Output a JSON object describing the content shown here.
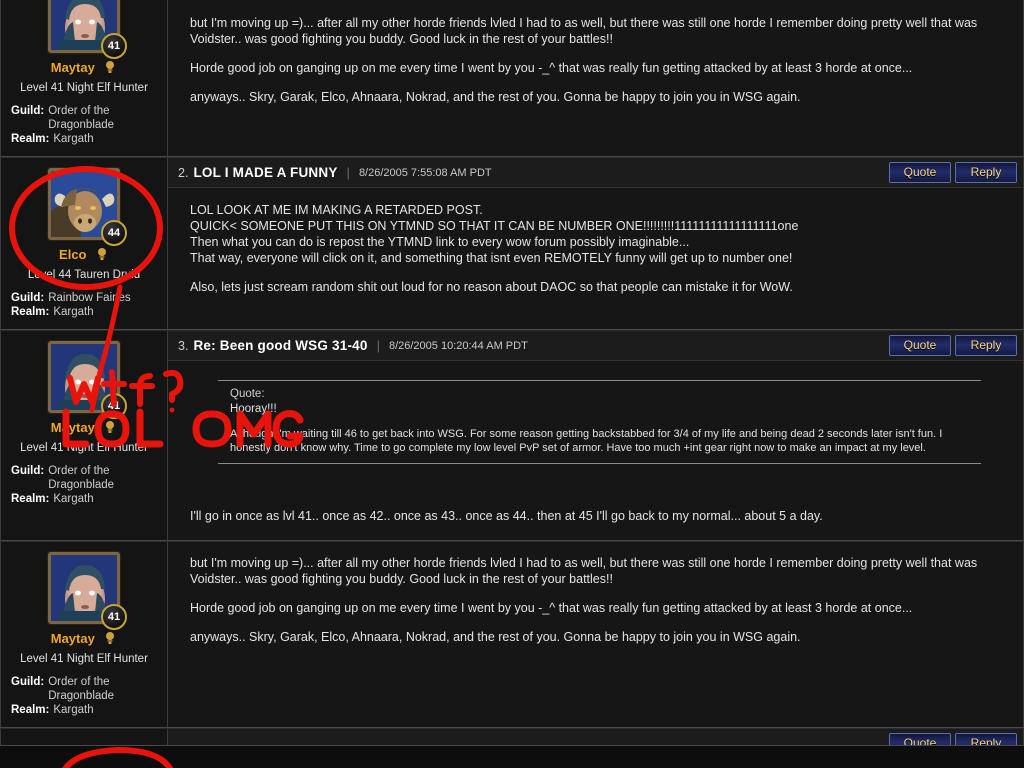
{
  "theme": {
    "page_bg": "#0d0d0d",
    "post_bg": "#161616",
    "author_bg": "#141414",
    "name_color": "#f0a81e",
    "button_text": "#f5d77a",
    "button_bg": "#232c6b",
    "ink_color": "#e8140c"
  },
  "buttons": {
    "quote": "Quote",
    "reply": "Reply"
  },
  "posts": [
    {
      "number": "",
      "title": "",
      "date": "",
      "author": {
        "name": "Maytay",
        "level": "41",
        "title": "Level 41 Night Elf Hunter",
        "guild_label": "Guild:",
        "guild": "Order of the Dragonblade",
        "realm_label": "Realm:",
        "realm": "Kargath",
        "class_icon": "hunter-class-icon",
        "avatar": "night-elf-female-avatar"
      },
      "paragraphs": [
        "but I'm moving up =)... after all my other horde friends lvled I had to as well, but there was still one horde I remember doing pretty well that was Voidster.. was good fighting you buddy. Good luck in the rest of your battles!!",
        "Horde good job on ganging up on me every time I went by you -_^ that was really fun getting attacked by at least 3 horde at once...",
        "anyways.. Skry, Garak, Elco, Ahnaara, Nokrad, and the rest of you. Gonna be happy to join you in WSG again."
      ]
    },
    {
      "number": "2.",
      "title": "LOL I MADE A FUNNY",
      "date": "8/26/2005 7:55:08 AM PDT",
      "author": {
        "name": "Elco",
        "level": "44",
        "title": "Level 44 Tauren Druid",
        "guild_label": "Guild:",
        "guild": "Rainbow Fairies",
        "realm_label": "Realm:",
        "realm": "Kargath",
        "class_icon": "druid-class-icon",
        "avatar": "tauren-male-avatar"
      },
      "lines": [
        "LOL LOOK AT ME IM MAKING A RETARDED POST.",
        "QUICK< SOMEONE PUT THIS ON YTMND SO THAT IT CAN BE NUMBER ONE!!!!!!!!!11111111111111111one",
        "Then what you can do is repost the YTMND link to every wow forum possibly imaginable...",
        "That way, everyone will click on it, and something that isnt even REMOTELY funny will get up to number one!"
      ],
      "closing": "Also, lets just scream random shit out loud for no reason about DAOC so that people can mistake it for WoW."
    },
    {
      "number": "3.",
      "title": "Re: Been good WSG 31-40",
      "date": "8/26/2005 10:20:44 AM PDT",
      "author": {
        "name": "Maytay",
        "level": "41",
        "title": "Level 41 Night Elf Hunter",
        "guild_label": "Guild:",
        "guild": "Order of the Dragonblade",
        "realm_label": "Realm:",
        "realm": "Kargath",
        "class_icon": "hunter-class-icon",
        "avatar": "night-elf-female-avatar"
      },
      "quote": {
        "label": "Quote:",
        "first_line": "Hooray!!!",
        "text": "Although I'm waiting till 46 to get back into WSG. For some reason getting backstabbed for 3/4 of my life and being dead 2 seconds later isn't fun. I honestly don't know why. Time to go complete my low level PvP set of armor. Have too much +int gear right now to make an impact at my level."
      },
      "reply": "I'll go in once as lvl 41.. once as 42.. once as 43.. once as 44.. then at 45 I'll go back to my normal... about 5 a day."
    },
    {
      "number": "",
      "title": "",
      "date": "",
      "author": {
        "name": "Maytay",
        "level": "41",
        "title": "Level 41 Night Elf Hunter",
        "guild_label": "Guild:",
        "guild": "Order of the Dragonblade",
        "realm_label": "Realm:",
        "realm": "Kargath",
        "class_icon": "hunter-class-icon",
        "avatar": "night-elf-female-avatar"
      },
      "paragraphs": [
        "but I'm moving up =)... after all my other horde friends lvled I had to as well, but there was still one horde I remember doing pretty well that was Voidster.. was good fighting you buddy. Good luck in the rest of your battles!!",
        "Horde good job on ganging up on me every time I went by you -_^ that was really fun getting attacked by at least 3 horde at once...",
        "anyways.. Skry, Garak, Elco, Ahnaara, Nokrad, and the rest of you. Gonna be happy to join you in WSG again."
      ]
    }
  ],
  "annotations": [
    {
      "name": "red-circle-elco-avatar",
      "kind": "ellipse",
      "text": ""
    },
    {
      "name": "red-arrow-elco-to-maytay",
      "kind": "arrow",
      "text": ""
    },
    {
      "name": "red-handwriting-wtf",
      "kind": "text",
      "text": "wtf?"
    },
    {
      "name": "red-handwriting-lol-omg",
      "kind": "text",
      "text": "LOL OMG"
    },
    {
      "name": "red-circle-bottom-partial",
      "kind": "ellipse",
      "text": ""
    }
  ]
}
